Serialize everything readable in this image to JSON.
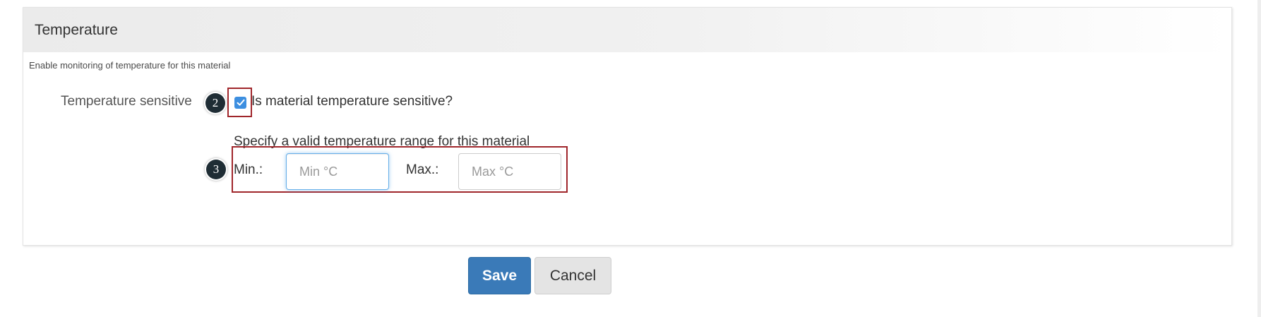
{
  "panel": {
    "title": "Temperature",
    "description": "Enable monitoring of temperature for this material"
  },
  "temperature_sensitive": {
    "label": "Temperature sensitive",
    "checkbox_label": "Is material temperature sensitive?",
    "checked": true,
    "checkbox_icon": "checkmark-icon"
  },
  "range": {
    "hint": "Specify a valid temperature range for this material",
    "min_label": "Min.:",
    "min_value": "",
    "min_placeholder": "Min °C",
    "max_label": "Max.:",
    "max_value": "",
    "max_placeholder": "Max °C"
  },
  "annotations": {
    "step_2": "2",
    "step_3": "3",
    "badge_color": "#1f2d35",
    "highlight_color": "#a0262b"
  },
  "actions": {
    "save_label": "Save",
    "cancel_label": "Cancel",
    "save_color": "#3a7ab8"
  }
}
